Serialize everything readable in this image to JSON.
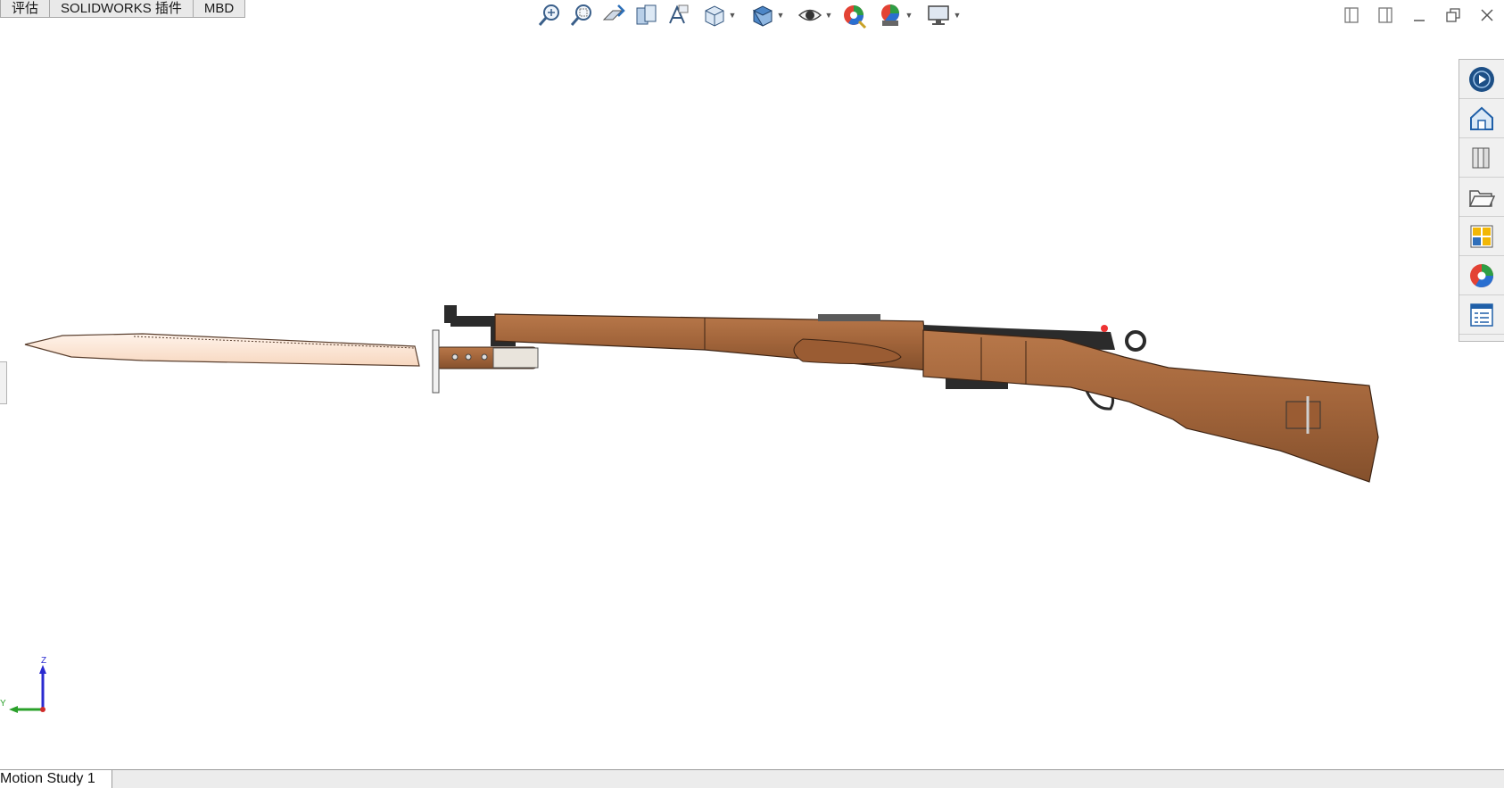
{
  "tabs": [
    "评估",
    "SOLIDWORKS 插件",
    "MBD"
  ],
  "bottom_tab": "Motion Study 1",
  "triad": {
    "z_label": "Z",
    "y_label": "Y"
  },
  "hud_icons": [
    "zoom-to-fit-icon",
    "zoom-to-area-icon",
    "previous-view-icon",
    "section-view-icon",
    "dynamic-annotation-views-icon",
    "view-orientation-icon",
    "display-style-icon",
    "hide-show-items-icon",
    "edit-appearance-icon",
    "apply-scene-icon",
    "view-settings-icon"
  ],
  "taskpane_icons": [
    "solidworks-resources-icon",
    "design-library-icon",
    "file-explorer-icon",
    "view-palette-icon",
    "appearances-scenes-icon",
    "custom-properties-icon"
  ],
  "colors": {
    "wood": "#a86a3d",
    "wood_dark": "#7a4622",
    "steel": "#2b2b2b",
    "blade": "#fbe3cf",
    "accent_blue": "#1f5fa8"
  }
}
